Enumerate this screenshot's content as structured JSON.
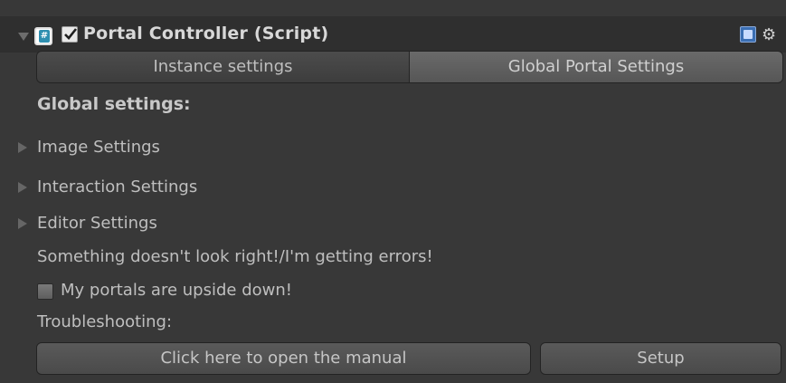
{
  "header": {
    "title": "Portal Controller (Script)",
    "enabled_check": "✔",
    "gear_glyph": "⚙"
  },
  "tabs": [
    {
      "label": "Instance settings",
      "active": false
    },
    {
      "label": "Global Portal Settings",
      "active": true
    }
  ],
  "main": {
    "heading": "Global settings:",
    "foldouts": [
      {
        "label": "Image Settings"
      },
      {
        "label": "Interaction Settings"
      },
      {
        "label": "Editor Settings"
      }
    ],
    "warning_text": "Something doesn't look right!/I'm getting errors!",
    "checkbox": {
      "label": "My portals are upside down!",
      "checked": false
    },
    "troubleshooting_label": "Troubleshooting:",
    "buttons": {
      "manual": "Click here to open the manual",
      "setup": "Setup"
    }
  },
  "colors": {
    "background": "#383838",
    "header": "#2f2f2f",
    "active_tab": "#5e5e5e",
    "text": "#bfbfbf"
  },
  "icons": [
    "foldout-arrow-down-icon",
    "script-icon",
    "checkbox-checked-icon",
    "help-icon",
    "gear-icon",
    "foldout-arrow-right-icon"
  ]
}
